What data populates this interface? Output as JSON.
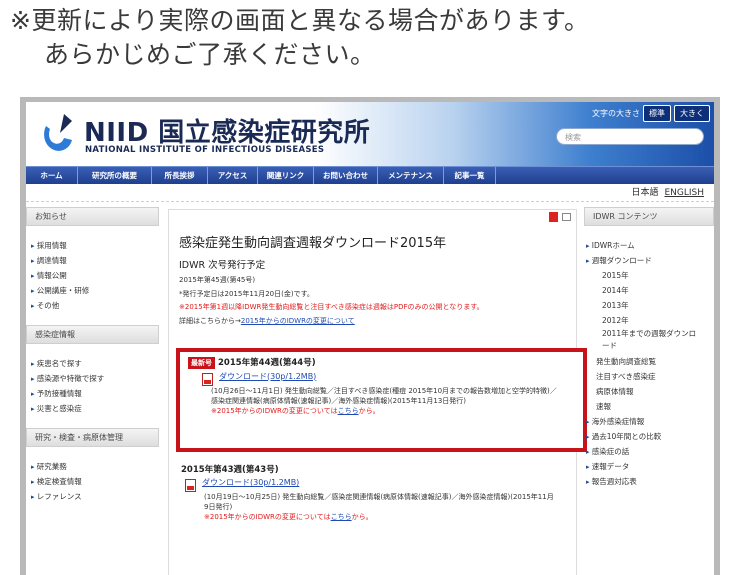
{
  "notice": {
    "line1": "※更新により実際の画面と異なる場合があります。",
    "line2": "あらかじめご了承ください。"
  },
  "header": {
    "logo_title": "NIID 国立感染症研究所",
    "logo_sub": "NATIONAL INSTITUTE OF INFECTIOUS DISEASES",
    "textsize_label": "文字の大きさ",
    "textsize_std": "標準",
    "textsize_large": "大きく",
    "search_placeholder": "検索"
  },
  "nav": [
    "ホーム",
    "研究所の概要",
    "所長挨拶",
    "アクセス",
    "関連リンク",
    "お問い合わせ",
    "メンテナンス",
    "記事一覧"
  ],
  "lang": {
    "ja": "日本語",
    "en": "ENGLISH"
  },
  "left": {
    "section1": "お知らせ",
    "items1": [
      "採用情報",
      "調達情報",
      "情報公開",
      "公開講座・研修",
      "その他"
    ],
    "section2": "感染症情報",
    "items2": [
      "疾患名で探す",
      "感染源や特徴で探す",
      "予防接種情報",
      "災害と感染症"
    ],
    "section3": "研究・検査・病原体管理",
    "items3": [
      "研究業務",
      "検定検査情報",
      "レファレンス"
    ]
  },
  "center": {
    "title": "感染症発生動向調査週報ダウンロード2015年",
    "subtitle": "IDWR 次号発行予定",
    "next_issue": "2015年第45週(第45号)",
    "next_date": "*発行予定日は2015年11月20日(金)です。",
    "red_note": "※2015年第1週以降IDWR発生動向総覧と注目すべき感染症は週報はPDFのみの公開となります。",
    "detail_prefix": "詳細はこちらから→",
    "detail_link": "2015年からのIDWRの変更について"
  },
  "latest_week": {
    "badge": "最新号",
    "title": "2015年第44週(第44号)",
    "download": "ダウンロード(30p/1.2MB)",
    "desc": "(10月26日～11月1日) 発生動向総覧／注目すべき感染症(種痘 2015年10月までの報告数増加と空学的特徴)／感染症関連情報(病原体情報(速報記事)／海外感染症情報)(2015年11月13日発行)",
    "note_prefix": "※2015年からのIDWRの変更については",
    "note_link": "こちら",
    "note_suffix": "から。"
  },
  "week2": {
    "title": "2015年第43週(第43号)",
    "download": "ダウンロード(30p/1.2MB)",
    "desc": "(10月19日～10月25日) 発生動向総覧／感染症関連情報(病原体情報(速報記事)／海外感染症情報)(2015年11月9日発行)",
    "note_prefix": "※2015年からのIDWRの変更については",
    "note_link": "こちら",
    "note_suffix": "から。"
  },
  "right": {
    "section": "IDWR コンテンツ",
    "items": [
      {
        "label": "IDWRホーム",
        "kind": "item"
      },
      {
        "label": "週報ダウンロード",
        "kind": "item"
      },
      {
        "label": "2015年",
        "kind": "sub"
      },
      {
        "label": "2014年",
        "kind": "sub"
      },
      {
        "label": "2013年",
        "kind": "sub"
      },
      {
        "label": "2012年",
        "kind": "sub"
      },
      {
        "label": "2011年までの週報ダウンロード",
        "kind": "sub-two"
      },
      {
        "label": "発生動向調査総覧",
        "kind": "plain"
      },
      {
        "label": "注目すべき感染症",
        "kind": "plain"
      },
      {
        "label": "病原体情報",
        "kind": "plain"
      },
      {
        "label": "速報",
        "kind": "plain"
      },
      {
        "label": "海外感染症情報",
        "kind": "item"
      },
      {
        "label": "過去10年間との比較",
        "kind": "item"
      },
      {
        "label": "感染症の話",
        "kind": "item"
      },
      {
        "label": "速報データ",
        "kind": "item"
      },
      {
        "label": "報告週対応表",
        "kind": "item"
      }
    ]
  },
  "colors": {
    "highlight_border": "#c8131b",
    "nav_bg": "#1f3f8f",
    "link": "#1f49b3",
    "alert_text": "#e31b1b"
  }
}
